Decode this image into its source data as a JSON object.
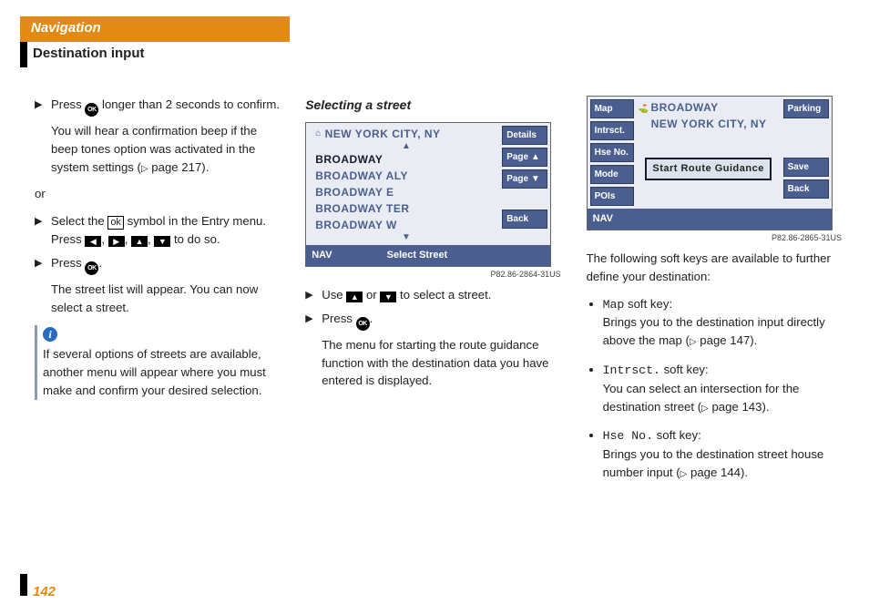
{
  "header": {
    "tab": "Navigation",
    "subhead": "Destination input"
  },
  "page_number": "142",
  "col1": {
    "step1_a": "Press ",
    "step1_b": " longer than 2 seconds to confirm.",
    "beep": "You will hear a confirmation beep if the beep tones option was activated in the system settings (",
    "beep_page": " page 217).",
    "or": "or",
    "step2_a": "Select the ",
    "ok_box": "ok",
    "step2_b": " symbol in the Entry menu. Press ",
    "step2_c": " to do so.",
    "step3_a": "Press ",
    "step3_b": ".",
    "listpara": "The street list will appear. You can now select a street.",
    "info": "If several options of streets are availab­le, another menu will appear where you must make and confirm your desired selection."
  },
  "col2": {
    "heading": "Selecting a street",
    "screen": {
      "city": "NEW YORK CITY, NY",
      "list": [
        "BROADWAY",
        "BROADWAY ALY",
        "BROADWAY E",
        "BROADWAY TER",
        "BROADWAY W"
      ],
      "right": [
        "Details",
        "Page ▲",
        "Page ▼",
        "Back"
      ],
      "footer_left": "NAV",
      "footer_center": "Select Street",
      "caption": "P82.86-2864-31US"
    },
    "use_a": "Use ",
    "use_b": " or ",
    "use_c": " to select a street.",
    "press_a": "Press ",
    "press_b": ".",
    "menu": "The menu for starting the route guidance function with the destination data you have entered is displayed."
  },
  "col3": {
    "screen": {
      "left": [
        "Map",
        "Intrsct.",
        "Hse No.",
        "Mode",
        "POIs"
      ],
      "right_top": "Parking",
      "right_save": "Save",
      "right_back": "Back",
      "line1": "BROADWAY",
      "line2": "NEW YORK CITY, NY",
      "start": "Start Route Guidance",
      "footer_left": "NAV",
      "caption": "P82.86-2865-31US"
    },
    "intro": "The following soft keys are available to further define your destination:",
    "items": [
      {
        "key": "Map",
        "label": " soft key:",
        "desc_a": "Brings you to the destination input directly above the map (",
        "desc_page": " page 147)."
      },
      {
        "key": "Intrsct.",
        "label": " soft key:",
        "desc_a": "You can select an intersection for the destination street (",
        "desc_page": " page 143)."
      },
      {
        "key": "Hse No.",
        "label": " soft key:",
        "desc_a": "Brings you to the destination street house number input (",
        "desc_page": " page 144)."
      }
    ]
  }
}
